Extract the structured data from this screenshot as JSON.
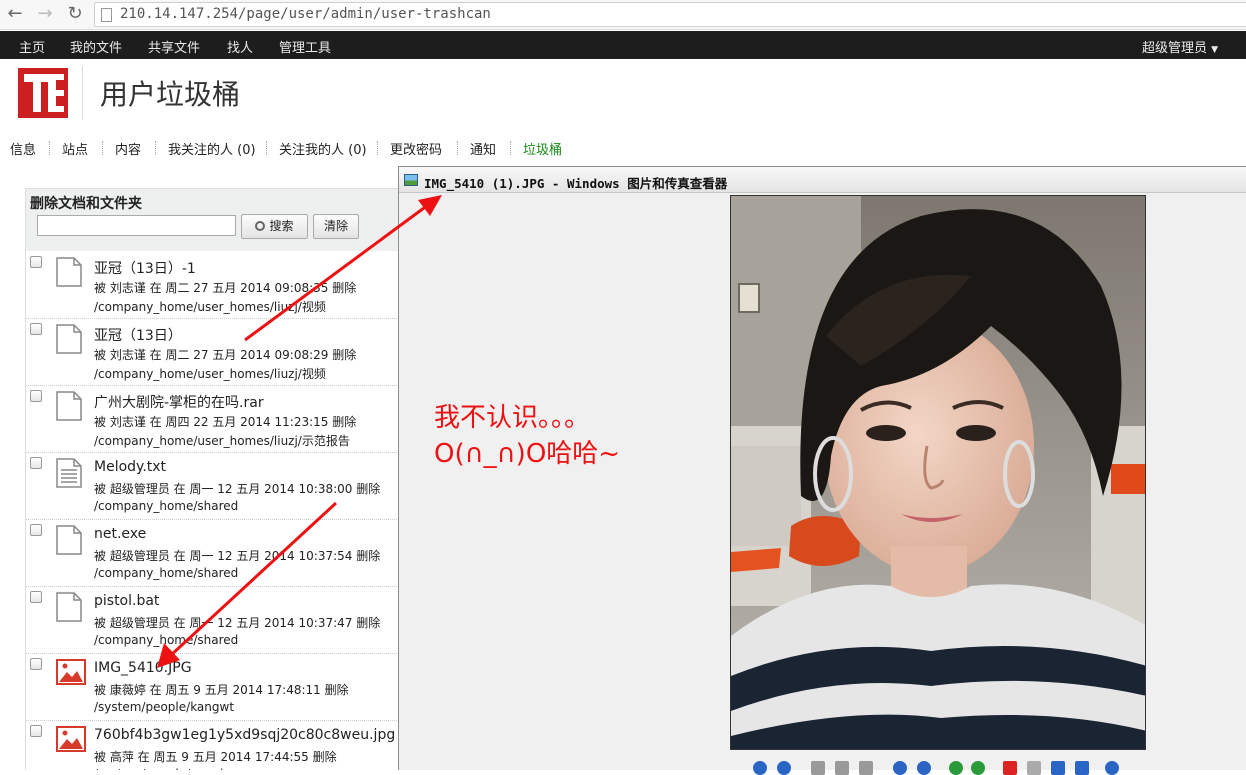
{
  "browser": {
    "url": "210.14.147.254/page/user/admin/user-trashcan"
  },
  "topnav": {
    "items": [
      "主页",
      "我的文件",
      "共享文件",
      "找人",
      "管理工具"
    ],
    "user": "超级管理员"
  },
  "page": {
    "title": "用户垃圾桶"
  },
  "subnav": {
    "items": [
      "信息",
      "站点",
      "内容",
      "我关注的人 (0)",
      "关注我的人 (0)",
      "更改密码",
      "通知",
      "垃圾桶"
    ],
    "active": "垃圾桶",
    "active_color": "#1a8a1a"
  },
  "panel": {
    "title": "删除文档和文件夹",
    "search_button": "搜索",
    "clear_button": "清除",
    "search_value": "",
    "rows": [
      {
        "name": "亚冠（13日）-1",
        "info": "被 刘志谨 在 周二 27 五月 2014 09:08:35 删除",
        "path": "/company_home/user_homes/liuzj/视频",
        "icon": "document-icon"
      },
      {
        "name": "亚冠（13日）",
        "info": "被 刘志谨 在 周二 27 五月 2014 09:08:29 删除",
        "path": "/company_home/user_homes/liuzj/视频",
        "icon": "document-icon"
      },
      {
        "name": "广州大剧院-掌柜的在吗.rar",
        "info": "被 刘志谨 在 周四 22 五月 2014 11:23:15 删除",
        "path": "/company_home/user_homes/liuzj/示范报告",
        "icon": "document-icon"
      },
      {
        "name": "Melody.txt",
        "info": "被 超级管理员 在 周一 12 五月 2014 10:38:00 删除",
        "path": "/company_home/shared",
        "icon": "text-file-icon"
      },
      {
        "name": "net.exe",
        "info": "被 超级管理员 在 周一 12 五月 2014 10:37:54 删除",
        "path": "/company_home/shared",
        "icon": "document-icon"
      },
      {
        "name": "pistol.bat",
        "info": "被 超级管理员 在 周一 12 五月 2014 10:37:47 删除",
        "path": "/company_home/shared",
        "icon": "document-icon"
      },
      {
        "name": "IMG_5410.JPG",
        "info": "被 康薇婷 在 周五 9 五月 2014 17:48:11 删除",
        "path": "/system/people/kangwt",
        "icon": "image-file-icon"
      },
      {
        "name": "760bf4b3gw1eg1y5xd9sqj20c80c8weu.jpg",
        "info": "被 高萍 在 周五 9 五月 2014 17:44:55 删除",
        "path": "/system/people/gaoping",
        "icon": "image-file-icon"
      }
    ]
  },
  "viewer": {
    "title": "IMG_5410 (1).JPG - Windows 图片和传真查看器",
    "annotation_line1": "我不认识。。。",
    "annotation_line2": "O(∩_∩)O哈哈~",
    "annotation_color": "#ee1111"
  }
}
